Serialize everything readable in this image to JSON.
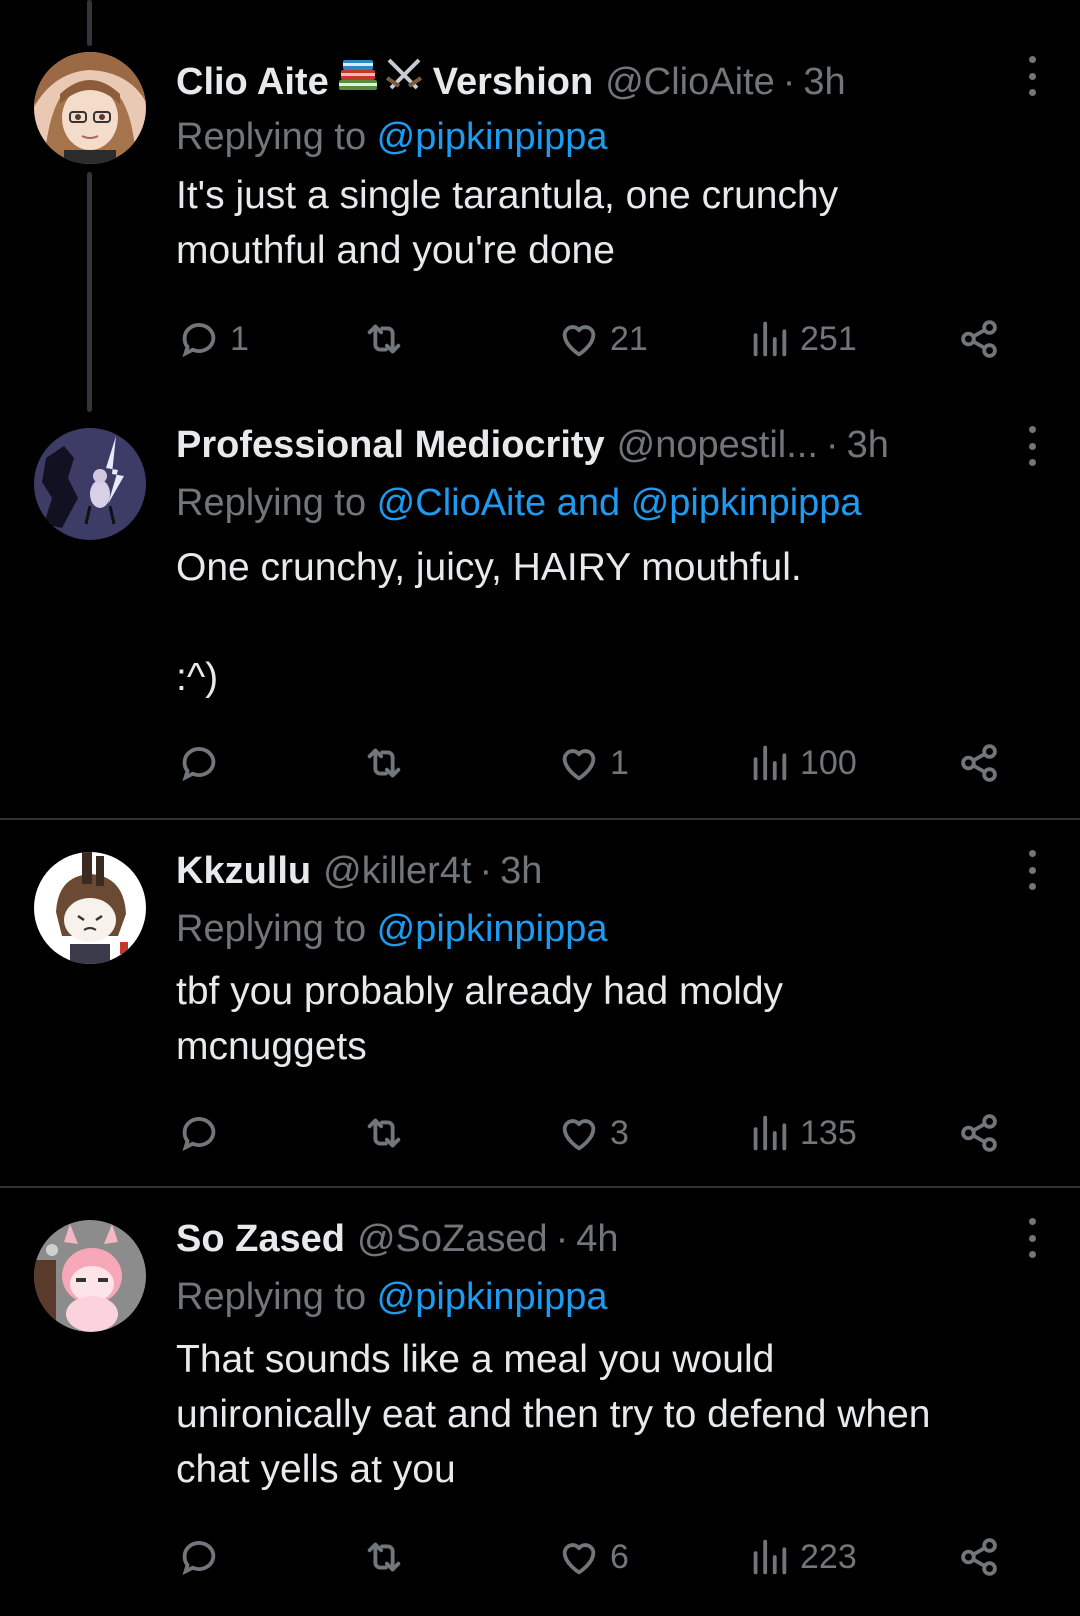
{
  "tweets": [
    {
      "name": "Clio Aite",
      "name_suffix": "Vershion",
      "name_emoji": [
        "books-emoji",
        "crossed-swords-emoji"
      ],
      "handle": "@ClioAite",
      "time": "3h",
      "reply_prefix": "Replying to ",
      "reply_to": "@pipkinpippa",
      "text": "It's just a single tarantula, one crunchy\nmouthful and you're done",
      "replies": "1",
      "reposts": "",
      "likes": "21",
      "views": "251"
    },
    {
      "name": "Professional Mediocrity",
      "handle": "@nopestil...",
      "time": "3h",
      "reply_prefix": "Replying to ",
      "reply_to": "@ClioAite and @pipkinpippa",
      "text": "One crunchy, juicy, HAIRY mouthful.\n\n:^)",
      "replies": "",
      "reposts": "",
      "likes": "1",
      "views": "100"
    },
    {
      "name": "Kkzullu",
      "handle": "@killer4t",
      "time": "3h",
      "reply_prefix": "Replying to ",
      "reply_to": "@pipkinpippa",
      "text": "tbf you probably already had moldy\nmcnuggets",
      "replies": "",
      "reposts": "",
      "likes": "3",
      "views": "135"
    },
    {
      "name": "So Zased",
      "handle": "@SoZased",
      "time": "4h",
      "reply_prefix": "Replying to ",
      "reply_to": "@pipkinpippa",
      "text": "That sounds like a meal you would\nunironically eat and then try to defend when\nchat yells at you",
      "replies": "",
      "reposts": "",
      "likes": "6",
      "views": "223"
    }
  ],
  "separator": "·",
  "colors": {
    "background": "#000000",
    "text": "#e7e9ea",
    "muted": "#71767b",
    "link": "#1d9bf0",
    "divider": "#2f3336"
  },
  "icons": {
    "reply": "speech-bubble-icon",
    "repost": "repost-arrows-icon",
    "like": "heart-icon",
    "views": "bar-chart-icon",
    "share": "share-nodes-icon",
    "more": "vertical-ellipsis-icon"
  }
}
